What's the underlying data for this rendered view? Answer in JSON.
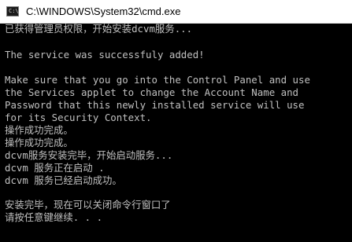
{
  "window": {
    "title": "C:\\WINDOWS\\System32\\cmd.exe",
    "icon": "cmd-icon",
    "icon_prompt": "C:\\"
  },
  "console": {
    "text_color": "#c0c0c0",
    "background_color": "#000000",
    "lines": [
      "已获得管理员权限，开始安装dcvm服务...",
      "",
      "The service was successfuly added!",
      "",
      "Make sure that you go into the Control Panel and use",
      "the Services applet to change the Account Name and",
      "Password that this newly installed service will use",
      "for its Security Context.",
      "操作成功完成。",
      "操作成功完成。",
      "dcvm服务安装完毕，开始启动服务...",
      "dcvm 服务正在启动 .",
      "dcvm 服务已经启动成功。",
      "",
      "安装完毕，现在可以关闭命令行窗口了",
      "请按任意键继续. . ."
    ]
  }
}
